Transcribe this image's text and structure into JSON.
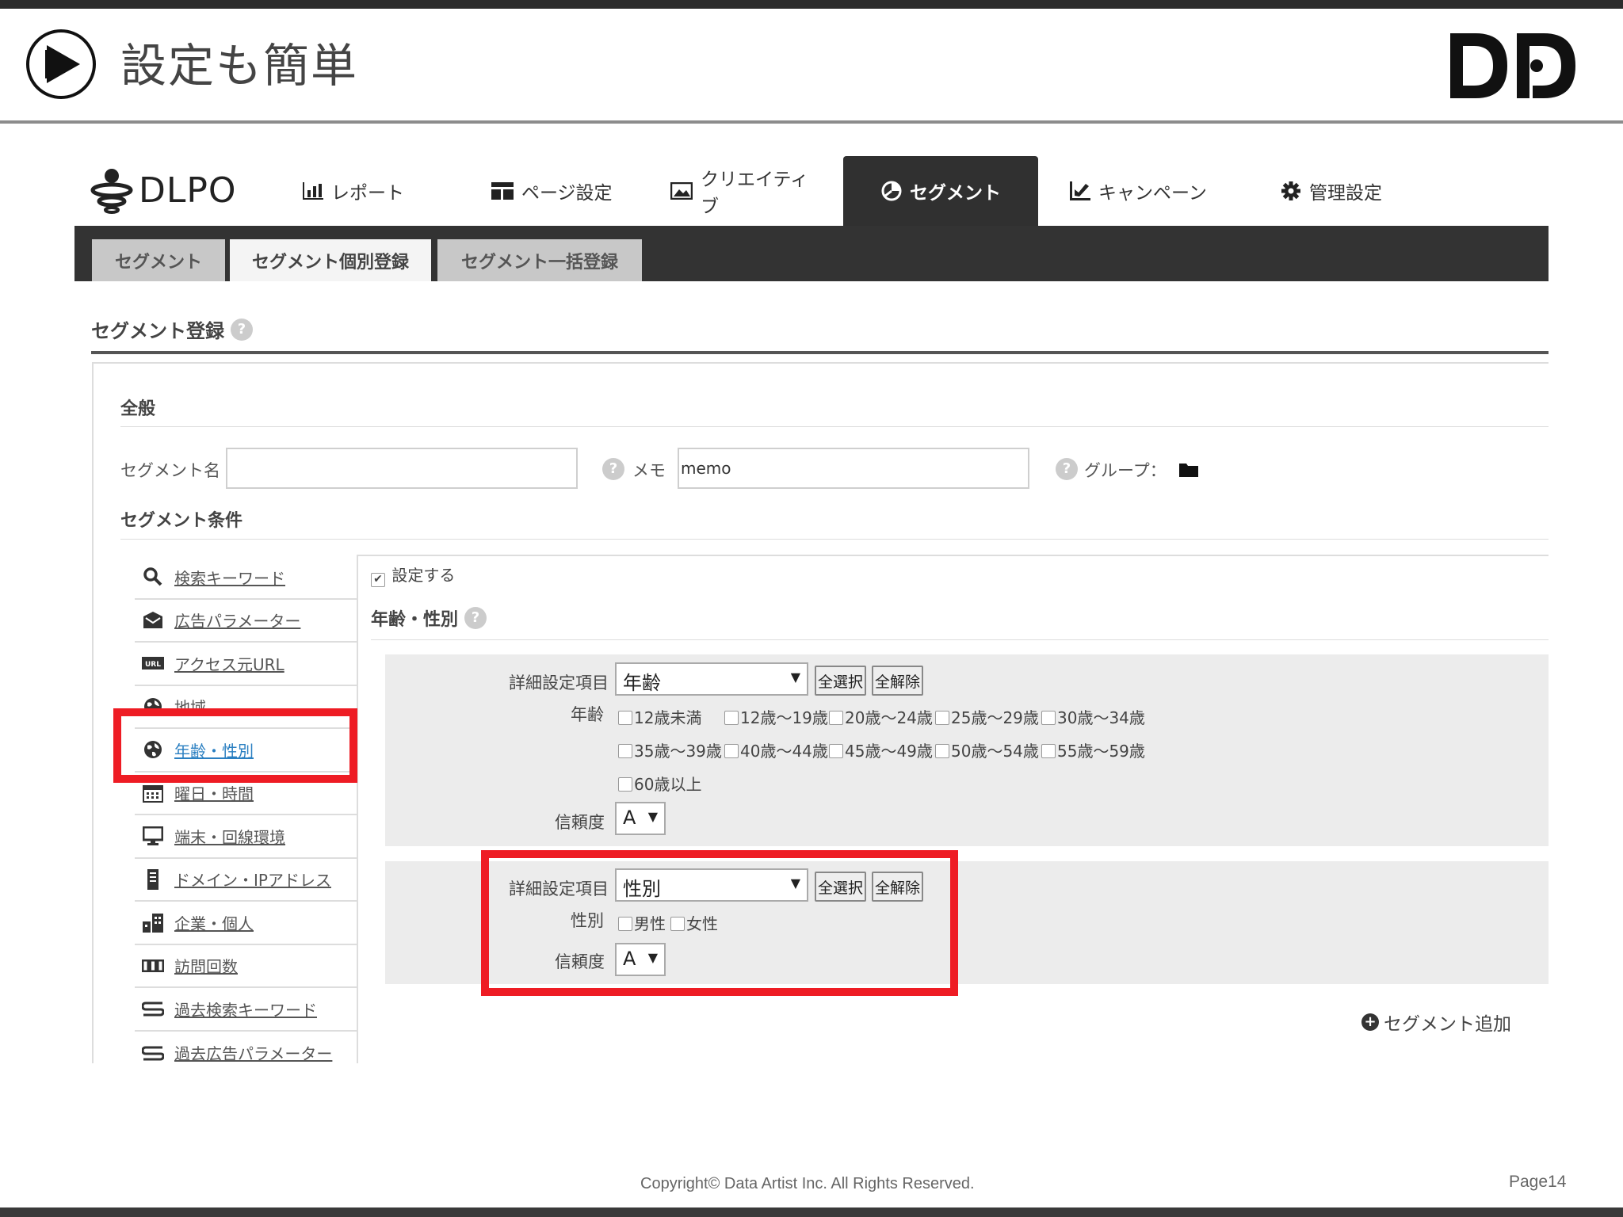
{
  "slide": {
    "title": "設定も簡単",
    "logo": "DP",
    "copyright": "Copyright© Data Artist Inc.  All Rights Reserved.",
    "page": "Page14"
  },
  "app": {
    "logo_text": "DLPO",
    "nav": [
      {
        "label": "レポート",
        "icon": "bar-chart-icon"
      },
      {
        "label": "ページ設定",
        "icon": "layout-icon"
      },
      {
        "label": "クリエイティブ",
        "icon": "image-icon"
      },
      {
        "label": "セグメント",
        "icon": "pie-chart-icon",
        "active": true
      },
      {
        "label": "キャンペーン",
        "icon": "chart-edit-icon"
      },
      {
        "label": "管理設定",
        "icon": "gear-icon"
      }
    ],
    "subtabs": [
      {
        "label": "セグメント"
      },
      {
        "label": "セグメント個別登録",
        "active": true
      },
      {
        "label": "セグメント一括登録"
      }
    ]
  },
  "form": {
    "section_title": "セグメント登録",
    "general_heading": "全般",
    "segment_name_label": "セグメント名",
    "segment_name_value": "",
    "memo_label": "メモ",
    "memo_value": "memo",
    "group_label": "グループ：",
    "conditions_heading": "セグメント条件",
    "set_checkbox_label": "設定する",
    "condition_title": "年齢・性別",
    "add_segment": "セグメント追加"
  },
  "sidebar": {
    "items": [
      {
        "label": "検索キーワード",
        "icon": "search-icon"
      },
      {
        "label": "広告パラメーター",
        "icon": "mail-icon"
      },
      {
        "label": "アクセス元URL",
        "icon": "url-icon"
      },
      {
        "label": "地域",
        "icon": "globe-icon"
      },
      {
        "label": "年齢・性別",
        "icon": "globe-icon",
        "active": true
      },
      {
        "label": "曜日・時間",
        "icon": "calendar-icon"
      },
      {
        "label": "端末・回線環境",
        "icon": "monitor-icon"
      },
      {
        "label": "ドメイン・IPアドレス",
        "icon": "server-icon"
      },
      {
        "label": "企業・個人",
        "icon": "building-icon"
      },
      {
        "label": "訪問回数",
        "icon": "counter-icon"
      },
      {
        "label": "過去検索キーワード",
        "icon": "history-icon"
      },
      {
        "label": "過去広告パラメーター",
        "icon": "history-icon"
      }
    ]
  },
  "age_block": {
    "detail_label": "詳細設定項目",
    "detail_value": "年齢",
    "select_all": "全選択",
    "deselect_all": "全解除",
    "age_label": "年齢",
    "options": [
      "12歳未満",
      "12歳～19歳",
      "20歳～24歳",
      "25歳～29歳",
      "30歳～34歳",
      "35歳～39歳",
      "40歳～44歳",
      "45歳～49歳",
      "50歳～54歳",
      "55歳～59歳",
      "60歳以上"
    ],
    "confidence_label": "信頼度",
    "confidence_value": "A"
  },
  "gender_block": {
    "detail_label": "詳細設定項目",
    "detail_value": "性別",
    "select_all": "全選択",
    "deselect_all": "全解除",
    "gender_label": "性別",
    "options": [
      "男性",
      "女性"
    ],
    "confidence_label": "信頼度",
    "confidence_value": "A"
  },
  "colors": {
    "highlight": "#ee1c24",
    "nav_dark": "#303030",
    "link_active": "#2a7fc1"
  }
}
